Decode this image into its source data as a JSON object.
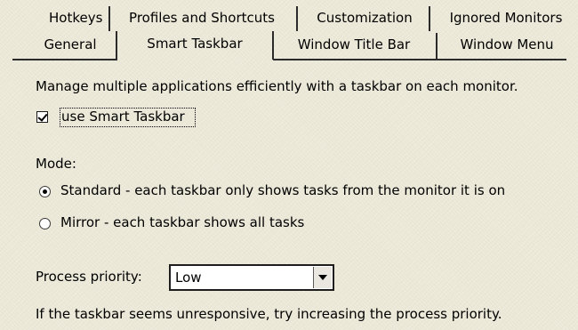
{
  "tabs": {
    "row1": [
      "Hotkeys",
      "Profiles and Shortcuts",
      "Customization",
      "Ignored Monitors"
    ],
    "row2": [
      "General",
      "Smart Taskbar",
      "Window Title Bar",
      "Window Menu"
    ],
    "active": "Smart Taskbar"
  },
  "panel": {
    "description": "Manage multiple applications efficiently with a taskbar on each monitor.",
    "use_smart_taskbar": {
      "label": "use Smart Taskbar",
      "checked": true
    },
    "mode": {
      "label": "Mode:",
      "options": [
        {
          "label": "Standard - each taskbar only shows tasks from the monitor it is on",
          "selected": true
        },
        {
          "label": "Mirror - each taskbar shows all tasks",
          "selected": false
        }
      ]
    },
    "priority": {
      "label": "Process priority:",
      "value": "Low"
    },
    "hint": "If the taskbar seems unresponsive, try increasing the process priority."
  }
}
